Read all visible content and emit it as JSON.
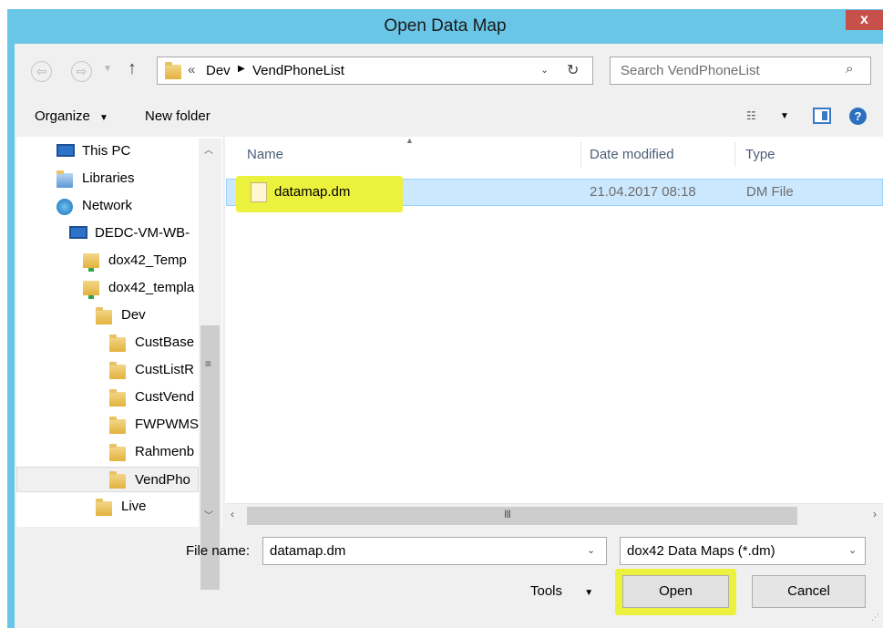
{
  "window": {
    "title": "Open Data Map",
    "close_glyph": "x"
  },
  "nav": {
    "back_icon": "back-arrow-icon",
    "forward_icon": "forward-arrow-icon",
    "up_icon": "up-arrow-icon",
    "breadcrumb_overflow": "«",
    "breadcrumb": [
      "Dev",
      "VendPhoneList"
    ],
    "search_placeholder": "Search VendPhoneList"
  },
  "toolbar": {
    "organize_label": "Organize",
    "new_folder_label": "New folder"
  },
  "tree": [
    {
      "label": "This PC",
      "icon": "pc-icon"
    },
    {
      "label": "Libraries",
      "icon": "libraries-icon"
    },
    {
      "label": "Network",
      "icon": "network-icon"
    },
    {
      "label": "DEDC-VM-WB-",
      "icon": "computer-icon"
    },
    {
      "label": "dox42_Temp",
      "icon": "network-folder-icon"
    },
    {
      "label": "dox42_templa",
      "icon": "network-folder-icon"
    },
    {
      "label": "Dev",
      "icon": "folder-icon"
    },
    {
      "label": "CustBase",
      "icon": "folder-icon"
    },
    {
      "label": "CustListR",
      "icon": "folder-icon"
    },
    {
      "label": "CustVend",
      "icon": "folder-icon"
    },
    {
      "label": "FWPWMS",
      "icon": "folder-icon"
    },
    {
      "label": "Rahmenb",
      "icon": "folder-icon"
    },
    {
      "label": "VendPho",
      "icon": "folder-icon"
    },
    {
      "label": "Live",
      "icon": "folder-icon"
    }
  ],
  "columns": {
    "name": "Name",
    "date": "Date modified",
    "type": "Type"
  },
  "files": [
    {
      "name": "datamap.dm",
      "date": "21.04.2017 08:18",
      "type": "DM File"
    }
  ],
  "bottom": {
    "file_name_label": "File name:",
    "file_name_value": "datamap.dm",
    "filter_value": "dox42 Data Maps (*.dm)",
    "tools_label": "Tools",
    "open_label": "Open",
    "cancel_label": "Cancel"
  },
  "colors": {
    "title_bar": "#6ac6e6",
    "highlight": "#ecf13d",
    "selection": "#cce8ff"
  }
}
